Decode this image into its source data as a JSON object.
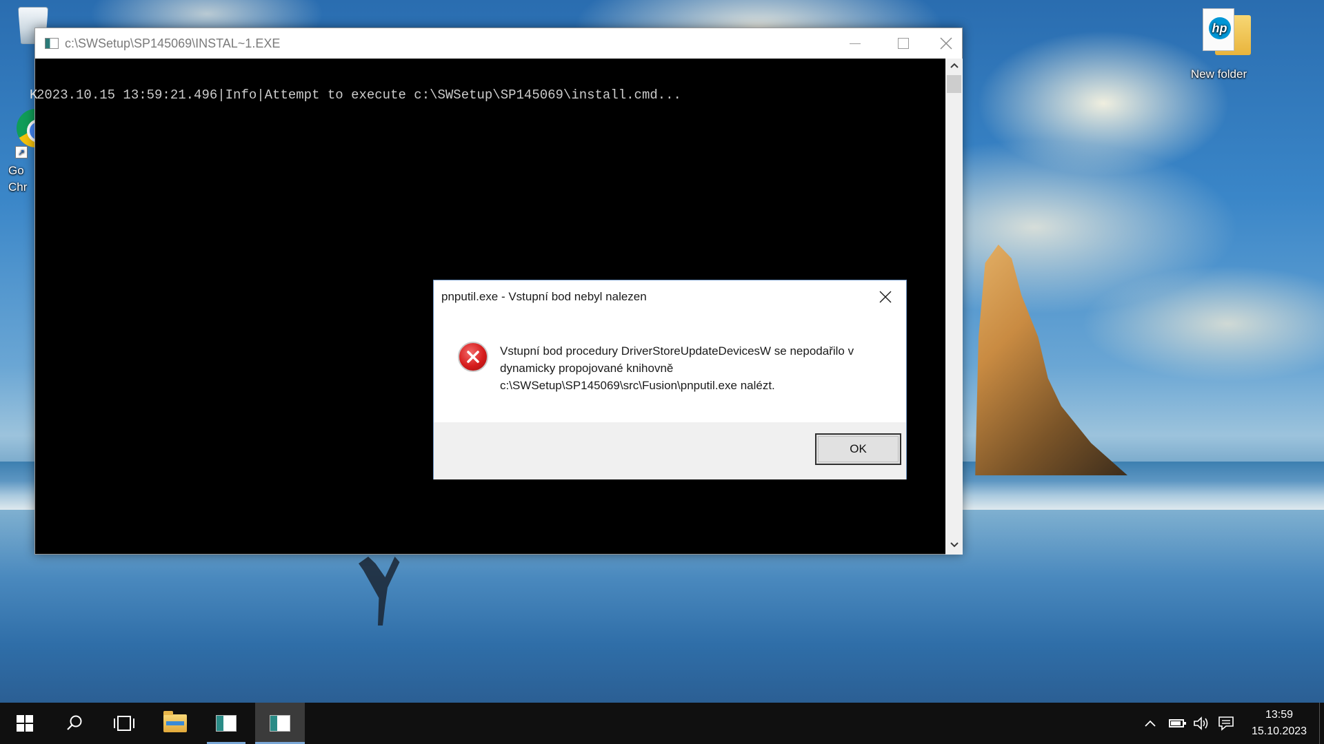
{
  "desktop": {
    "icons": [
      {
        "label": ""
      },
      {
        "label": "Go\nChr"
      },
      {
        "label": "New folder"
      }
    ]
  },
  "console_window": {
    "title": "c:\\SWSetup\\SP145069\\INSTAL~1.EXE",
    "ghost_char": "K",
    "log_line": "2023.10.15 13:59:21.496|Info|Attempt to execute c:\\SWSetup\\SP145069\\install.cmd...",
    "controls": {
      "minimize": "—",
      "maximize": "□",
      "close": "✕"
    }
  },
  "dialog": {
    "title": "pnputil.exe - Vstupní bod nebyl nalezen",
    "message_line1": "Vstupní bod procedury DriverStoreUpdateDevicesW se nepodařilo v",
    "message_line2": "dynamicky propojované knihovně",
    "message_line3": "c:\\SWSetup\\SP145069\\src\\Fusion\\pnputil.exe nalézt.",
    "ok_label": "OK",
    "icon": "error-icon"
  },
  "taskbar": {
    "items": [
      "start",
      "search",
      "task-view",
      "file-explorer",
      "console",
      "console"
    ],
    "tray": {
      "time": "13:59",
      "date": "15.10.2023"
    }
  },
  "colors": {
    "taskbar": "#101010",
    "console_bg": "#000000",
    "console_text": "#cccccc",
    "dialog_footer": "#f0f0f0",
    "error_red": "#d61c1c"
  }
}
